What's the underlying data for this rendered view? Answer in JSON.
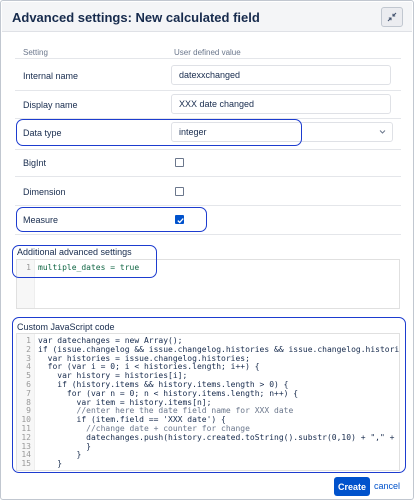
{
  "dialog": {
    "title": "Advanced settings: New calculated field",
    "collapse_icon": "collapse-arrows-icon"
  },
  "table": {
    "col_setting": "Setting",
    "col_value": "User defined value",
    "rows": {
      "internal_name": {
        "label": "Internal name",
        "value": "datexxchanged"
      },
      "display_name": {
        "label": "Display name",
        "value": "XXX date changed"
      },
      "data_type": {
        "label": "Data type",
        "value": "integer"
      },
      "bigint": {
        "label": "BigInt",
        "checked": false
      },
      "dimension": {
        "label": "Dimension",
        "checked": false
      },
      "measure": {
        "label": "Measure",
        "checked": true
      }
    }
  },
  "additional": {
    "label": "Additional advanced settings",
    "line_numbers": [
      "1"
    ],
    "code": [
      "multiple_dates = true"
    ]
  },
  "custom_js": {
    "label": "Custom JavaScript code",
    "line_numbers": [
      "1",
      "2",
      "3",
      "4",
      "5",
      "6",
      "7",
      "8",
      "9",
      "10",
      "11",
      "12",
      "13",
      "14",
      "15"
    ],
    "code": [
      "var datechanges = new Array();",
      "if (issue.changelog && issue.changelog.histories && issue.changelog.histories.le",
      "  var histories = issue.changelog.histories;",
      "  for (var i = 0; i < histories.length; i++) {",
      "    var history = histories[i];",
      "    if (history.items && history.items.length > 0) {",
      "      for (var n = 0; n < history.items.length; n++) {",
      "        var item = history.items[n];",
      "        //enter here the date field name for XXX date",
      "        if (item.field == 'XXX date') {",
      "          //change date + counter for change",
      "          datechanges.push(history.created.toString().substr(0,10) + \",\" + 1);",
      "          }",
      "        }",
      "    }"
    ]
  },
  "footer": {
    "create_label": "Create",
    "cancel_label": "cancel"
  },
  "colors": {
    "highlight": "#1d3ccf",
    "primary": "#0052cc"
  }
}
